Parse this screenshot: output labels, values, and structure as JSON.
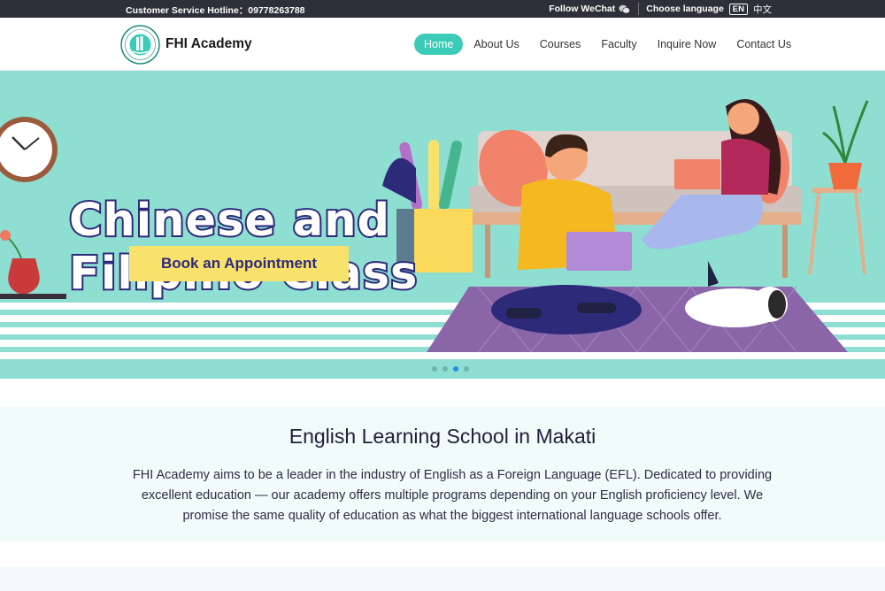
{
  "topbar": {
    "hotline": "Customer Service Hotline：09778263788",
    "follow_wechat": "Follow WeChat",
    "choose_language": "Choose language",
    "lang_en": "EN",
    "lang_zh": "中文"
  },
  "header": {
    "brand": "FHI Academy",
    "nav": [
      {
        "label": "Home",
        "active": true
      },
      {
        "label": "About Us"
      },
      {
        "label": "Courses"
      },
      {
        "label": "Faculty"
      },
      {
        "label": "Inquire Now"
      },
      {
        "label": "Contact Us"
      }
    ]
  },
  "banner": {
    "headline_line1": "Chinese and",
    "headline_line2": "Filipino Class",
    "cta": "Book an Appointment",
    "slide_count": 4,
    "active_slide": 3,
    "colors": {
      "background": "#8edfd2",
      "cta": "#f9e26b",
      "text_outline": "#2d2a7a"
    }
  },
  "intro": {
    "title": "English Learning School in Makati",
    "body": "FHI Academy aims to be a leader in the industry of English as a Foreign Language (EFL). Dedicated to providing excellent education — our academy offers multiple programs depending on your English proficiency level. We promise the same quality of education as what the biggest international language schools offer."
  },
  "colors": {
    "accent": "#3ccbb9",
    "topbar": "#2e2f38"
  }
}
